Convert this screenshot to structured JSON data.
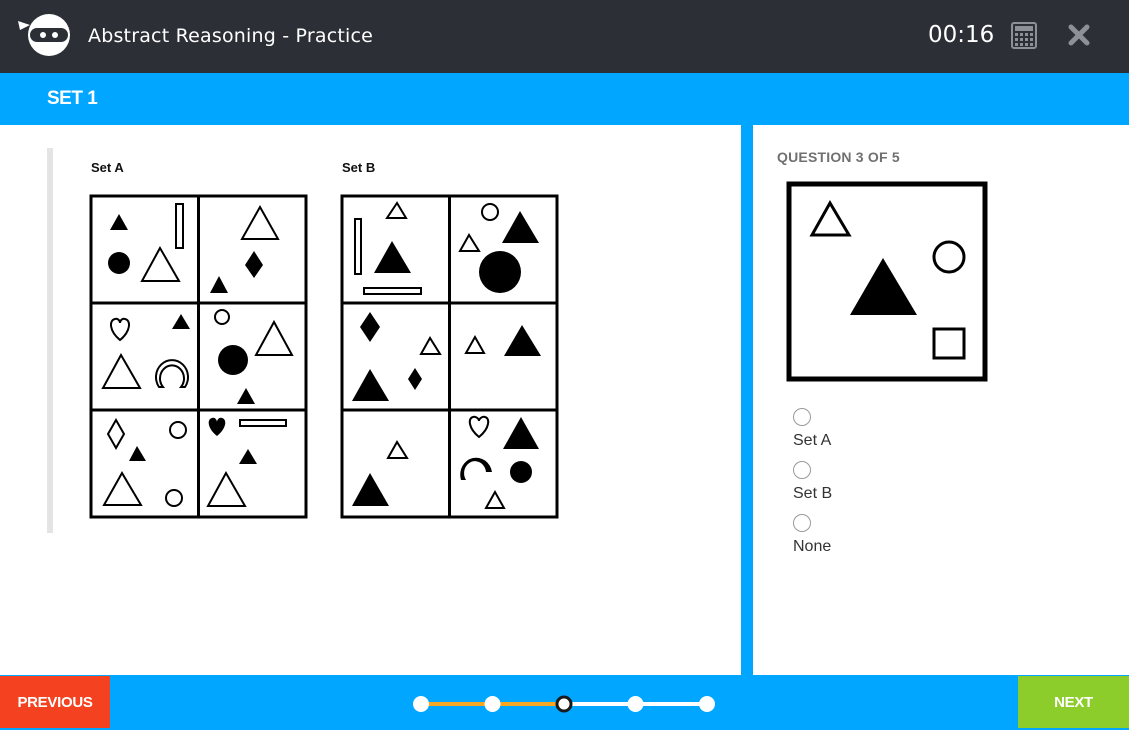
{
  "header": {
    "title": "Abstract Reasoning - Practice",
    "timer": "00:16",
    "icons": [
      "ninja-logo-icon",
      "calculator-icon",
      "close-icon"
    ]
  },
  "set_bar": {
    "title": "SET 1"
  },
  "figure": {
    "set_a_label": "Set A",
    "set_b_label": "Set B"
  },
  "question": {
    "counter": "QUESTION 3 OF 5",
    "options": [
      {
        "label": "Set A",
        "selected": false
      },
      {
        "label": "Set B",
        "selected": false
      },
      {
        "label": "None",
        "selected": false
      }
    ]
  },
  "footer": {
    "previous_label": "PREVIOUS",
    "next_label": "NEXT",
    "progress": {
      "current": 3,
      "total": 5
    }
  },
  "colors": {
    "header_bg": "#2c2f36",
    "accent_blue": "#00a6ff",
    "previous_red": "#f4411f",
    "next_green": "#8ccd2c",
    "progress_orange": "#f5a623"
  }
}
